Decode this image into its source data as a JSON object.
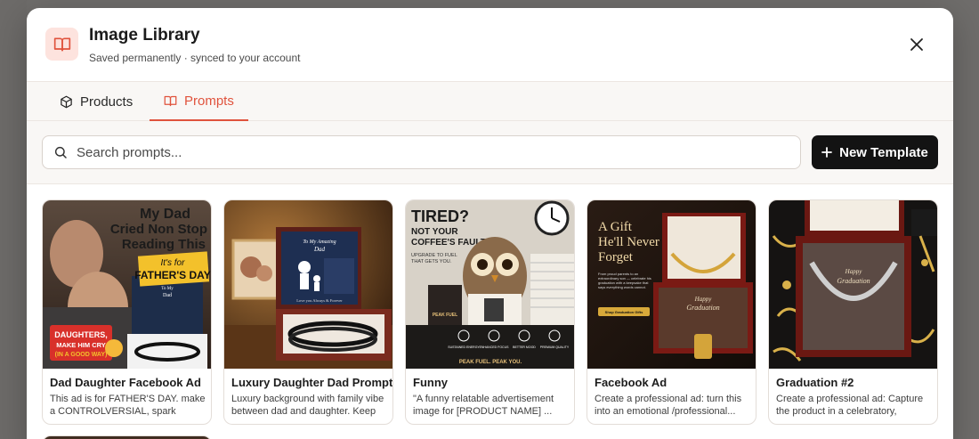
{
  "header": {
    "title": "Image Library",
    "subtitle": "Saved permanently · synced to your account",
    "icon": "book-open-icon",
    "accent": "#e0533d"
  },
  "tabs": [
    {
      "label": "Products",
      "icon": "package-icon",
      "active": false
    },
    {
      "label": "Prompts",
      "icon": "book-open-icon",
      "active": true
    }
  ],
  "search": {
    "placeholder": "Search prompts..."
  },
  "new_template_label": "New Template",
  "cards": [
    {
      "title": "Dad Daughter Facebook Ad",
      "description": "This ad is for FATHER'S DAY. make a CONTROLVERSIAL, spark discussio...",
      "image": {
        "headline": [
          "My Dad",
          "Cried Non Stop",
          "Reading This"
        ],
        "tag": [
          "It's for",
          "FATHER'S DAY"
        ],
        "box_text": [
          "To My",
          "Dad"
        ],
        "badge": [
          "DAUGHTERS,",
          "MAKE HIM CRY",
          "(IN A GOOD WAY)"
        ]
      }
    },
    {
      "title": "Luxury Daughter Dad Prompt",
      "description": "Luxury background with family vibe between dad and daughter. Keep th...",
      "image": {
        "card_text": [
          "To My Amazing",
          "Dad"
        ],
        "footer": "Love you Always & Forever"
      }
    },
    {
      "title": "Funny",
      "description": "\"A funny relatable advertisement image for [PRODUCT NAME] ...",
      "image": {
        "headline": [
          "TIRED?",
          "NOT YOUR",
          "COFFEE'S FAULT."
        ],
        "sub": [
          "UPGRADE TO FUEL",
          "THAT GETS YOU."
        ],
        "product": "PEAK FUEL",
        "benefits": [
          "SUSTAINED ENERGY",
          "ENHANCED FOCUS",
          "BETTER MOOD",
          "PREMIUM QUALITY"
        ],
        "footer": "PEAK FUEL. PEAK YOU."
      }
    },
    {
      "title": "Facebook Ad",
      "description": "Create a professional ad: turn this into an emotional /professional...",
      "image": {
        "headline": [
          "A Gift",
          "He'll Never",
          "Forget"
        ],
        "body": "From proud parents to an extraordinary son — celebrate his graduation with a keepsake that says everything words cannot.",
        "cta": "Shop Graduation Gifts",
        "card_text": [
          "Happy",
          "Graduation"
        ]
      }
    },
    {
      "title": "Graduation #2",
      "description": "Create a professional ad: Capture the product in a celebratory, warm,...",
      "image": {
        "card_text": [
          "Happy",
          "Graduation"
        ]
      }
    }
  ]
}
